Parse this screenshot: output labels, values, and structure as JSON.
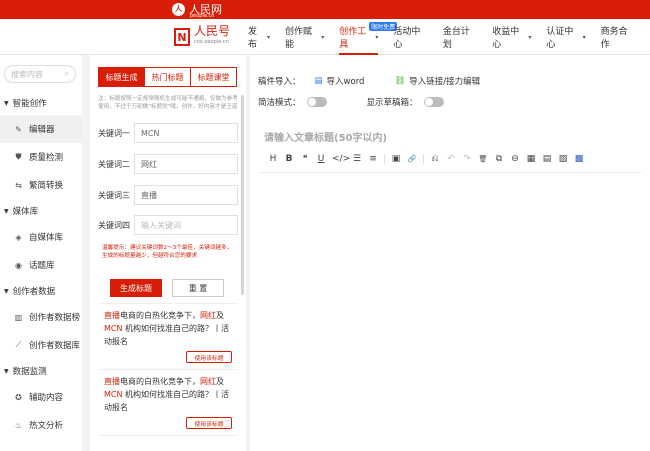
{
  "topbar": {
    "logo_text": "人民网",
    "logo_sub": "people.cn"
  },
  "brand": {
    "mark": "N",
    "name": "人民号",
    "sub": "coo.people.cn"
  },
  "nav": {
    "items": [
      {
        "label": "发布",
        "caret": "▾"
      },
      {
        "label": "创作赋能",
        "caret": "▾"
      },
      {
        "label": "创作工具",
        "caret": "▾",
        "badge": "限时免费"
      },
      {
        "label": "活动中心"
      },
      {
        "label": "金台计划"
      },
      {
        "label": "收益中心",
        "caret": "▾"
      },
      {
        "label": "认证中心",
        "caret": "▾"
      },
      {
        "label": "商务合作"
      }
    ]
  },
  "sidebar": {
    "search_placeholder": "搜索内容",
    "groups": [
      {
        "label": "智能创作",
        "items": [
          {
            "label": "编辑器",
            "icon": "pen-icon"
          },
          {
            "label": "质量检测",
            "icon": "shield-icon"
          },
          {
            "label": "繁简转换",
            "icon": "swap-icon"
          }
        ]
      },
      {
        "label": "媒体库",
        "items": [
          {
            "label": "自媒体库",
            "icon": "layers-icon"
          },
          {
            "label": "话题库",
            "icon": "target-icon"
          }
        ]
      },
      {
        "label": "创作者数据",
        "items": [
          {
            "label": "创作者数据榜",
            "icon": "bar-chart-icon"
          },
          {
            "label": "创作者数据库",
            "icon": "line-chart-icon"
          }
        ]
      },
      {
        "label": "数据监测",
        "items": [
          {
            "label": "辅助内容",
            "icon": "compass-icon"
          },
          {
            "label": "热文分析",
            "icon": "fire-icon"
          }
        ]
      }
    ]
  },
  "panel": {
    "tabs": [
      "标题生成",
      "热门标题",
      "标题课堂"
    ],
    "note": "注：标题按照一定规律随机生成可能不通顺，仅做为参考使用，不过千万别做\"标题党\"哦，创作，好内容才是王道",
    "keywords": [
      {
        "label": "关键词一",
        "value": "MCN"
      },
      {
        "label": "关键词二",
        "value": "网红"
      },
      {
        "label": "关键词三",
        "value": "直播"
      },
      {
        "label": "关键词四",
        "placeholder": "输入关键词"
      }
    ],
    "tip": "温馨提示：建议关键词数2～3个最佳，关键词越多，生成的标题量越少，但越符合您的要求",
    "generate_label": "生成标题",
    "reset_label": "重 置",
    "results": [
      {
        "t1": "直播",
        "t2": "电商的白热化竞争下，",
        "t3": "网红",
        "t4": "及",
        "t5": "MCN",
        "t6": " 机构如何找准自己的路？丨活动报名",
        "btn": "使用该标题"
      },
      {
        "t1": "直播",
        "t2": "电商的白热化竞争下，",
        "t3": "网红",
        "t4": "及",
        "t5": "MCN",
        "t6": " 机构如何找准自己的路？丨活动报名",
        "btn": "使用该标题"
      }
    ]
  },
  "editor": {
    "import_label": "稿件导入：",
    "import_word": "导入word",
    "import_link": "导入链接/接力编辑",
    "simple_mode": "简洁模式：",
    "show_source": "显示草稿箱：",
    "title_placeholder": "请输入文章标题(50字以内)",
    "toolbar": [
      "H",
      "B",
      "❝",
      "U",
      "</>",
      "☰",
      "≡",
      "▣",
      "🔗",
      "⎌",
      "↶",
      "↷",
      "🗑",
      "⧉",
      "⊖",
      "▦",
      "▤",
      "▨",
      "▩"
    ]
  },
  "colors": {
    "brand_red": "#d81e06",
    "badge_blue": "#2d78f4"
  }
}
